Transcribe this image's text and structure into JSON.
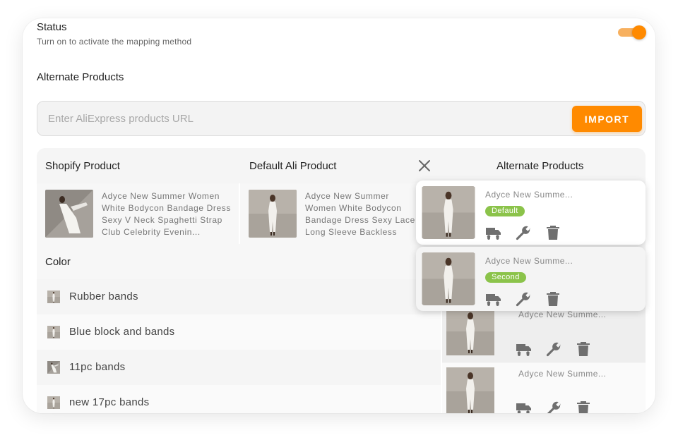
{
  "status": {
    "title": "Status",
    "subtitle": "Turn on to activate the mapping method",
    "toggle_on": true,
    "accent_color": "#ff8a00"
  },
  "alternate_section": {
    "title": "Alternate Products",
    "url_input": {
      "value": "",
      "placeholder": "Enter AliExpress products URL"
    },
    "import_label": "IMPORT"
  },
  "table": {
    "headers": {
      "shopify": "Shopify Product",
      "default": "Default Ali Product",
      "alternate": "Alternate Products"
    },
    "shopify_product": "Adyce New Summer Women White Bodycon Bandage Dress Sexy V Neck Spaghetti Strap Club Celebrity Evenin...",
    "default_product": "Adyce New Summer Women White Bodycon Bandage Dress Sexy Lace Long Sleeve Backless Celebrity Runway",
    "color_header": "Color",
    "color_options": [
      "Rubber bands",
      "Blue block and bands",
      "11pc bands",
      "new 17pc bands"
    ],
    "alternate_rows": [
      {
        "name": "Adyce New Summe..."
      },
      {
        "name": "Adyce New Summe..."
      }
    ]
  },
  "popup_items": [
    {
      "name": "Adyce New Summe...",
      "badge": "Default"
    },
    {
      "name": "Adyce New Summe...",
      "badge": "Second"
    }
  ],
  "icons": [
    "truck-icon",
    "wrench-icon",
    "trash-icon",
    "close-icon"
  ]
}
